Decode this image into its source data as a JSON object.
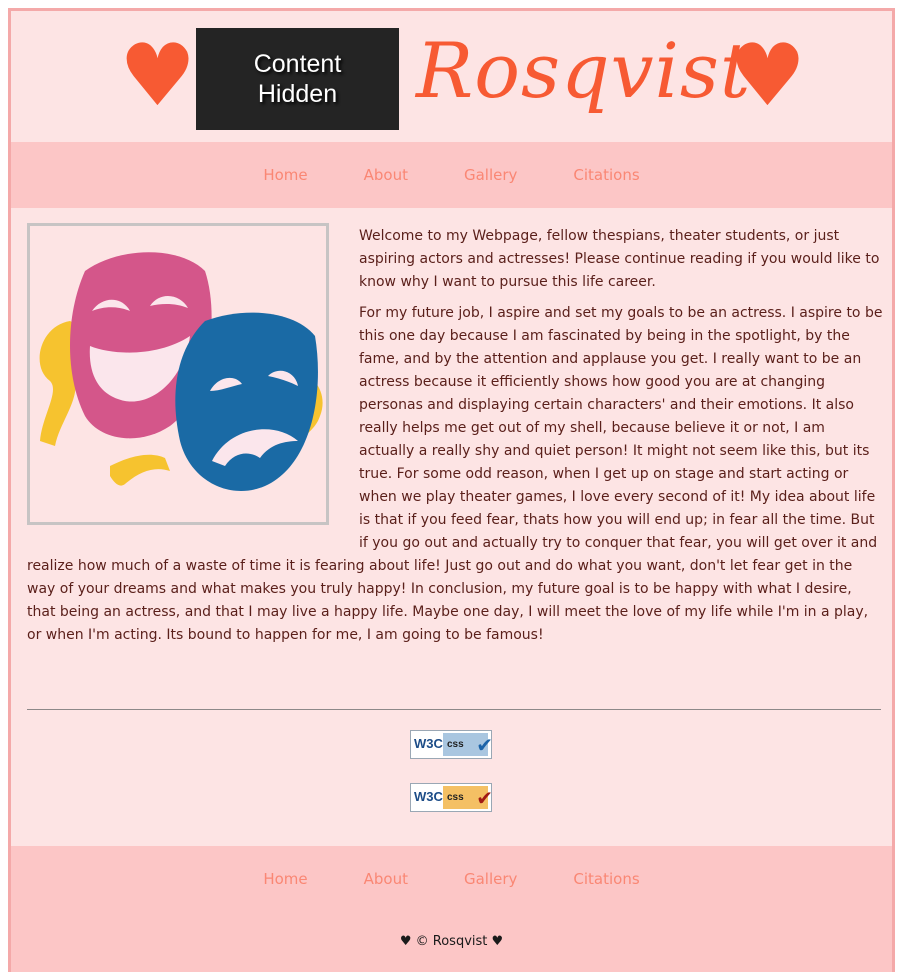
{
  "header": {
    "heart_glyph": "♥",
    "hidden_label": "Content Hidden",
    "logo_text": "Rosqvist"
  },
  "nav": {
    "items": [
      "Home",
      "About",
      "Gallery",
      "Citations"
    ]
  },
  "main": {
    "image_icon": "theater-masks",
    "paragraph_1": "Welcome to my Webpage, fellow thespians, theater students, or just aspiring actors and actresses! Please continue reading if you would like to know why I want to pursue this life career.",
    "paragraph_2": "For my future job, I aspire and set my goals to be an actress. I aspire to be this one day because I am fascinated by being in the spotlight, by the fame, and by the attention and applause you get. I really want to be an actress because it efficiently shows how good you are at changing personas and displaying certain characters' and their emotions. It also really helps me get out of my shell, because believe it or not, I am actually a really shy and quiet person! It might not seem like this, but its true. For some odd reason, when I get up on stage and start acting or when we play theater games, I love every second of it! My idea about life is that if you feed fear, thats how you will end up; in fear all the time. But if you go out and actually try to conquer that fear, you will get over it and realize how much of a waste of time it is fearing about life! Just go out and do what you want, don't let fear get in the way of your dreams and what makes you truly happy! In conclusion, my future goal is to be happy with what I desire, that being an actress, and that I may live a happy life. Maybe one day, I will meet the love of my life while I'm in a play, or when I'm acting. Its bound to happen for me, I am going to be famous!"
  },
  "badges": [
    {
      "w3c": "W3C",
      "css": "css",
      "check": "✔"
    },
    {
      "w3c": "W3C",
      "css": "css",
      "check": "✔"
    }
  ],
  "footer": {
    "nav_items": [
      "Home",
      "About",
      "Gallery",
      "Citations"
    ],
    "copyright": "♥ © Rosqvist ♥"
  },
  "colors": {
    "accent": "#f75a33",
    "nav_link": "#fa8774",
    "page_bg": "#fde4e4",
    "nav_bg": "#fcc6c6"
  }
}
